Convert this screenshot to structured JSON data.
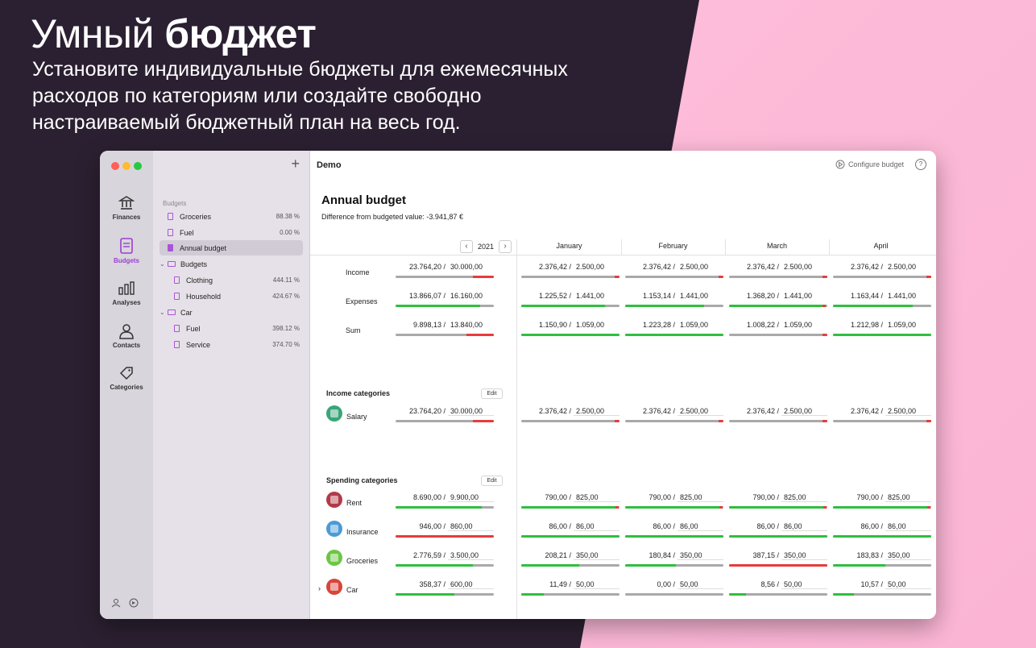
{
  "hero": {
    "title_light": "Умный",
    "title_bold": "бюджет",
    "subtitle_lines": [
      "Установите индивидуальные бюджеты для ежемесячных",
      "расходов по категориям или создайте свободно",
      "настраиваемый бюджетный план на весь год."
    ]
  },
  "nav": {
    "items": [
      {
        "label": "Finances",
        "icon": "bank-icon"
      },
      {
        "label": "Budgets",
        "icon": "budget-doc-icon"
      },
      {
        "label": "Analyses",
        "icon": "bar-chart-icon"
      },
      {
        "label": "Contacts",
        "icon": "person-icon"
      },
      {
        "label": "Categories",
        "icon": "tag-icon"
      }
    ]
  },
  "sidebar": {
    "add": "+",
    "section": "Budgets",
    "rows": [
      {
        "label": "Groceries",
        "pct": "88.38 %"
      },
      {
        "label": "Fuel",
        "pct": "0.00 %"
      },
      {
        "label": "Annual budget",
        "pct": ""
      },
      {
        "label": "Budgets",
        "pct": ""
      },
      {
        "label": "Clothing",
        "pct": "444.11 %"
      },
      {
        "label": "Household",
        "pct": "424.67 %"
      },
      {
        "label": "Car",
        "pct": ""
      },
      {
        "label": "Fuel",
        "pct": "398.12 %"
      },
      {
        "label": "Service",
        "pct": "374.70 %"
      }
    ]
  },
  "toolbar": {
    "title": "Demo",
    "configure": "Configure budget",
    "help": "?"
  },
  "budget": {
    "title": "Annual budget",
    "difference": "Difference from budgeted value: -3.941,87 €",
    "year": "2021",
    "prev": "‹",
    "next": "›",
    "months": [
      "January",
      "February",
      "March",
      "April"
    ],
    "summary_rows": [
      {
        "label": "Income",
        "total": {
          "a": "23.764,20",
          "b": "30.000,00",
          "pct": 0.79,
          "status": "over"
        },
        "months": [
          {
            "a": "2.376,42",
            "b": "2.500,00",
            "pct": 0.95,
            "status": "over"
          },
          {
            "a": "2.376,42",
            "b": "2.500,00",
            "pct": 0.95,
            "status": "over"
          },
          {
            "a": "2.376,42",
            "b": "2.500,00",
            "pct": 0.95,
            "status": "over"
          },
          {
            "a": "2.376,42",
            "b": "2.500,00",
            "pct": 0.95,
            "status": "over"
          }
        ]
      },
      {
        "label": "Expenses",
        "total": {
          "a": "13.866,07",
          "b": "16.160,00",
          "pct": 0.86,
          "status": "ok"
        },
        "months": [
          {
            "a": "1.225,52",
            "b": "1.441,00",
            "pct": 0.85,
            "status": "ok"
          },
          {
            "a": "1.153,14",
            "b": "1.441,00",
            "pct": 0.8,
            "status": "ok"
          },
          {
            "a": "1.368,20",
            "b": "1.441,00",
            "pct": 0.95,
            "status": "ok"
          },
          {
            "a": "1.163,44",
            "b": "1.441,00",
            "pct": 0.81,
            "status": "ok"
          }
        ]
      },
      {
        "label": "Sum",
        "total": {
          "a": "9.898,13",
          "b": "13.840,00",
          "pct": 0.72,
          "status": "over"
        },
        "months": [
          {
            "a": "1.150,90",
            "b": "1.059,00",
            "pct": 1.0,
            "status": "ok"
          },
          {
            "a": "1.223,28",
            "b": "1.059,00",
            "pct": 1.0,
            "status": "ok"
          },
          {
            "a": "1.008,22",
            "b": "1.059,00",
            "pct": 0.95,
            "status": "over"
          },
          {
            "a": "1.212,98",
            "b": "1.059,00",
            "pct": 1.0,
            "status": "ok"
          }
        ]
      }
    ],
    "income_title": "Income categories",
    "edit": "Edit",
    "income_rows": [
      {
        "label": "Salary",
        "icon": "salary-icon",
        "color": "#3aa57a",
        "total": {
          "a": "23.764,20",
          "b": "30.000,00",
          "pct": 0.79,
          "status": "over"
        },
        "months": [
          {
            "a": "2.376,42",
            "b": "2.500,00",
            "pct": 0.95,
            "status": "over"
          },
          {
            "a": "2.376,42",
            "b": "2.500,00",
            "pct": 0.95,
            "status": "over"
          },
          {
            "a": "2.376,42",
            "b": "2.500,00",
            "pct": 0.95,
            "status": "over"
          },
          {
            "a": "2.376,42",
            "b": "2.500,00",
            "pct": 0.95,
            "status": "over"
          }
        ]
      }
    ],
    "spending_title": "Spending categories",
    "spending_rows": [
      {
        "label": "Rent",
        "icon": "house-icon",
        "color": "#b23a48",
        "total": {
          "a": "8.690,00",
          "b": "9.900,00",
          "pct": 0.88,
          "status": "ok"
        },
        "months": [
          {
            "a": "790,00",
            "b": "825,00",
            "pct": 0.96,
            "status": "ok"
          },
          {
            "a": "790,00",
            "b": "825,00",
            "pct": 0.96,
            "status": "ok"
          },
          {
            "a": "790,00",
            "b": "825,00",
            "pct": 0.96,
            "status": "ok"
          },
          {
            "a": "790,00",
            "b": "825,00",
            "pct": 0.96,
            "status": "ok"
          }
        ]
      },
      {
        "label": "Insurance",
        "icon": "shield-icon",
        "color": "#4a9bd6",
        "total": {
          "a": "946,00",
          "b": "860,00",
          "pct": 1.0,
          "status": "bad"
        },
        "months": [
          {
            "a": "86,00",
            "b": "86,00",
            "pct": 1.0,
            "status": "ok"
          },
          {
            "a": "86,00",
            "b": "86,00",
            "pct": 1.0,
            "status": "ok"
          },
          {
            "a": "86,00",
            "b": "86,00",
            "pct": 1.0,
            "status": "ok"
          },
          {
            "a": "86,00",
            "b": "86,00",
            "pct": 1.0,
            "status": "ok"
          }
        ]
      },
      {
        "label": "Groceries",
        "icon": "apple-icon",
        "color": "#6cc644",
        "total": {
          "a": "2.776,59",
          "b": "3.500,00",
          "pct": 0.79,
          "status": "ok"
        },
        "months": [
          {
            "a": "208,21",
            "b": "350,00",
            "pct": 0.59,
            "status": "ok"
          },
          {
            "a": "180,84",
            "b": "350,00",
            "pct": 0.52,
            "status": "ok"
          },
          {
            "a": "387,15",
            "b": "350,00",
            "pct": 1.0,
            "status": "bad"
          },
          {
            "a": "183,83",
            "b": "350,00",
            "pct": 0.53,
            "status": "ok"
          }
        ]
      },
      {
        "label": "Car",
        "icon": "car-icon",
        "color": "#d8453a",
        "total": {
          "a": "358,37",
          "b": "600,00",
          "pct": 0.6,
          "status": "ok"
        },
        "months": [
          {
            "a": "11,49",
            "b": "50,00",
            "pct": 0.23,
            "status": "ok"
          },
          {
            "a": "0,00",
            "b": "50,00",
            "pct": 0.0,
            "status": "ok"
          },
          {
            "a": "8,56",
            "b": "50,00",
            "pct": 0.17,
            "status": "ok"
          },
          {
            "a": "10,57",
            "b": "50,00",
            "pct": 0.21,
            "status": "ok"
          }
        ]
      }
    ]
  },
  "colors": {
    "ok": "#2fbf3f",
    "over": "#e83b3b",
    "bad": "#e83b3b",
    "accent": "#9b3fd1"
  }
}
